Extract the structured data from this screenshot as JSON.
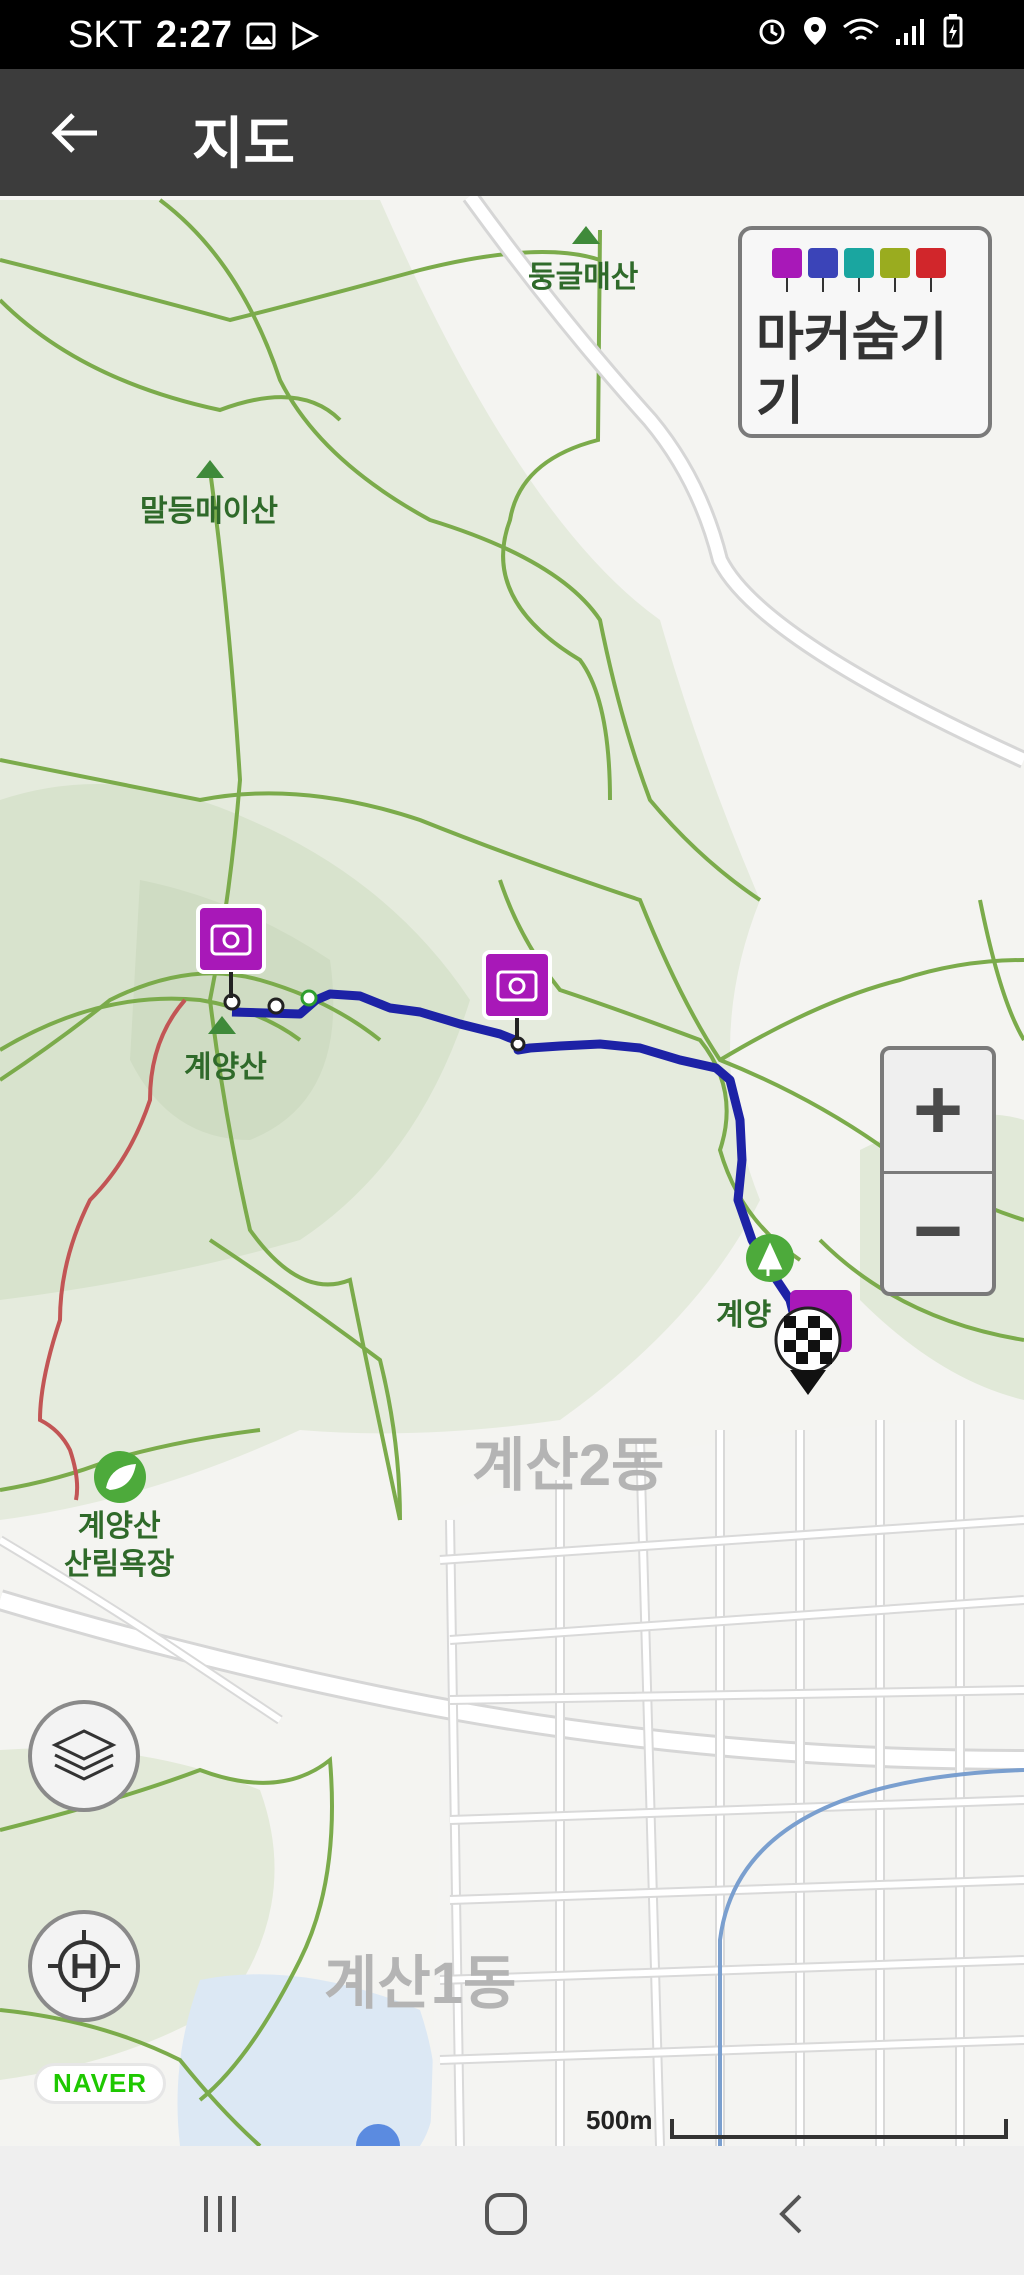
{
  "status_bar": {
    "carrier": "SKT",
    "time": "2:27"
  },
  "app_bar": {
    "title": "지도"
  },
  "marker_toggle": {
    "label": "마커숨기기"
  },
  "zoom": {
    "in_label": "+",
    "out_label": "−"
  },
  "map_labels": {
    "peak_1": "둥글매산",
    "peak_2": "말등매이산",
    "peak_3": "계양산",
    "trail_end": "계양",
    "forest": "계양산\n산림욕장",
    "dong_1": "계산2동",
    "dong_2": "계산1동"
  },
  "logo": "NAVER",
  "scale_text": "500m",
  "colors": {
    "route": "#1d22a6",
    "camera_marker": "#a818b8",
    "contour": "#7bab4b",
    "status_bar": "#000000",
    "app_bar": "#3c3c3c"
  },
  "icons": {
    "back": "arrow-left-icon",
    "layers": "layers-icon",
    "locate": "crosshair-h-icon",
    "camera": "camera-icon",
    "finish": "checkered-flag-icon"
  }
}
